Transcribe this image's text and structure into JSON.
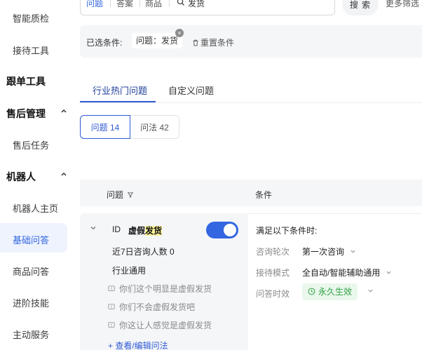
{
  "sidebar": {
    "items": [
      {
        "label": "智能质检",
        "kind": "sub"
      },
      {
        "label": "接待工具",
        "kind": "sub"
      },
      {
        "label": "跟单工具",
        "kind": "group"
      },
      {
        "label": "售后管理",
        "kind": "group",
        "expanded": true
      },
      {
        "label": "售后任务",
        "kind": "sub"
      },
      {
        "label": "机器人",
        "kind": "group",
        "expanded": true
      },
      {
        "label": "机器人主页",
        "kind": "sub"
      },
      {
        "label": "基础问答",
        "kind": "sub",
        "active": true
      },
      {
        "label": "商品问答",
        "kind": "sub"
      },
      {
        "label": "进阶技能",
        "kind": "sub"
      },
      {
        "label": "主动服务",
        "kind": "sub"
      }
    ]
  },
  "search": {
    "segments": [
      "问题",
      "答案",
      "商品"
    ],
    "active_segment": "问题",
    "value": "发货",
    "button_label": "搜 索",
    "more_label": "更多筛选"
  },
  "filters": {
    "label": "已选条件:",
    "chip": "问题：发货",
    "reset_label": "重置条件"
  },
  "tabs": [
    {
      "label": "行业热门问题",
      "active": true
    },
    {
      "label": "自定义问题",
      "active": false
    }
  ],
  "segmented": {
    "left": "问题 14",
    "right": "问法 42"
  },
  "table": {
    "headers": {
      "question": "问题",
      "condition": "条件"
    },
    "row": {
      "id_label": "ID",
      "title_prefix": "虚假",
      "title_highlight": "发货",
      "enabled": true,
      "consult_count": "近7日咨询人数 0",
      "scope": "行业通用",
      "alt_phrasings": [
        "你们这个明显是虚假发货",
        "你们不会虚假发货吧",
        "你这让人感觉是虚假发货"
      ],
      "edit_link": "+ 查看/编辑问法",
      "cond_title": "满足以下条件时:",
      "conditions": [
        {
          "label": "咨询轮次",
          "value": "第一次咨询"
        },
        {
          "label": "接待模式",
          "value": "全自动/智能辅助通用"
        },
        {
          "label": "问答时效",
          "value": "永久生效"
        }
      ]
    }
  },
  "colors": {
    "accent": "#3366e0",
    "highlight": "#fcf29a",
    "success": "#2ea043"
  }
}
